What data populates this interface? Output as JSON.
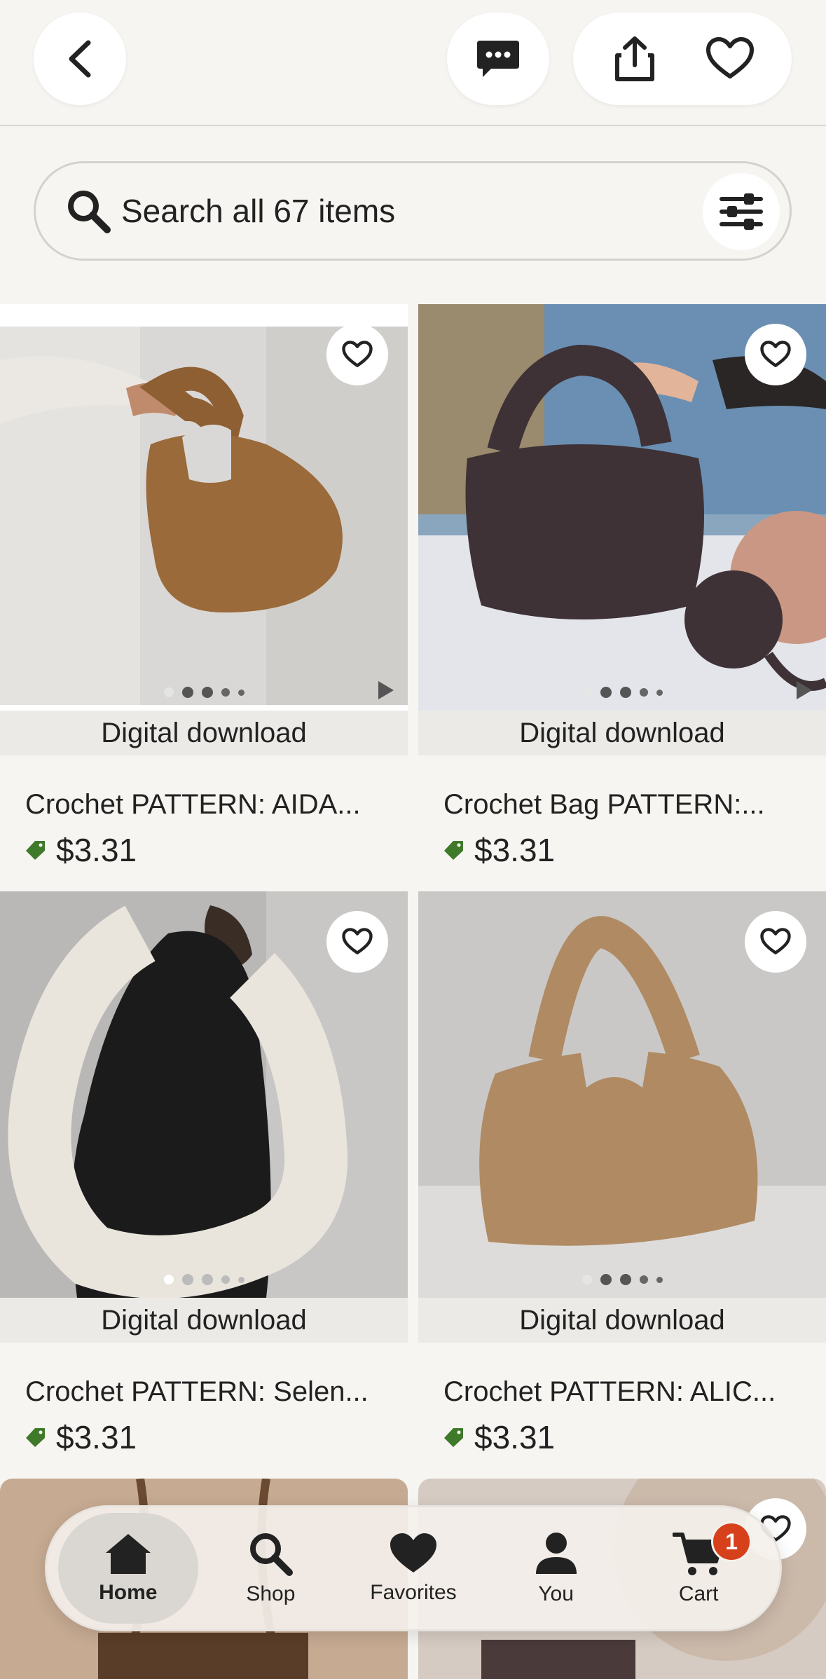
{
  "header": {
    "back_icon": "chevron-left-icon",
    "message_icon": "message-icon",
    "share_icon": "share-icon",
    "favorite_icon": "heart-icon"
  },
  "search": {
    "placeholder": "Search all 67 items",
    "filter_icon": "sliders-icon"
  },
  "products": [
    {
      "badge": "Digital download",
      "title": "Crochet PATTERN: AIDA...",
      "price": "$3.31"
    },
    {
      "badge": "Digital download",
      "title": "Crochet Bag PATTERN:...",
      "price": "$3.31"
    },
    {
      "badge": "Digital download",
      "title": "Crochet PATTERN: Selen...",
      "price": "$3.31"
    },
    {
      "badge": "Digital download",
      "title": "Crochet PATTERN: ALIC...",
      "price": "$3.31"
    }
  ],
  "bottom_nav": {
    "items": [
      {
        "label": "Home",
        "icon": "home-icon"
      },
      {
        "label": "Shop",
        "icon": "search-icon"
      },
      {
        "label": "Favorites",
        "icon": "heart-icon"
      },
      {
        "label": "You",
        "icon": "user-icon"
      },
      {
        "label": "Cart",
        "icon": "cart-icon"
      }
    ],
    "cart_count": "1"
  },
  "colors": {
    "background": "#f6f5f1",
    "price_tag": "#3f7a2a",
    "cart_badge": "#d6401a"
  }
}
